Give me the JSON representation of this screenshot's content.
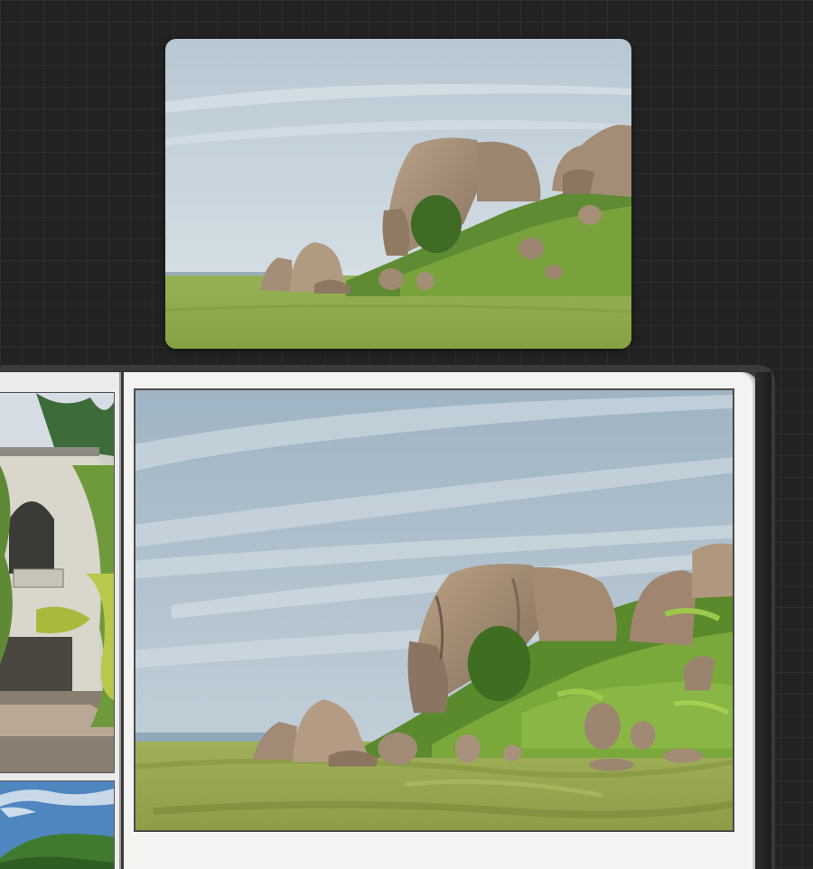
{
  "canvas": {
    "background_color": "#222222",
    "grid": true
  },
  "reference_photo": {
    "subject": "photo",
    "colors": {
      "sky": "#c9d6df",
      "grass": "#8aa94a",
      "rock": "#a58f78",
      "bush": "#4f7d2c"
    }
  },
  "sketchbook": {
    "painting": {
      "subject": "painting",
      "colors": {
        "sky": "#aebfcc",
        "grass": "#97a853",
        "rock": "#a58c72",
        "bush": "#5e9a32"
      }
    },
    "left_page": {
      "thumbnails": [
        {
          "subject": "building"
        },
        {
          "subject": "hill"
        }
      ]
    }
  }
}
